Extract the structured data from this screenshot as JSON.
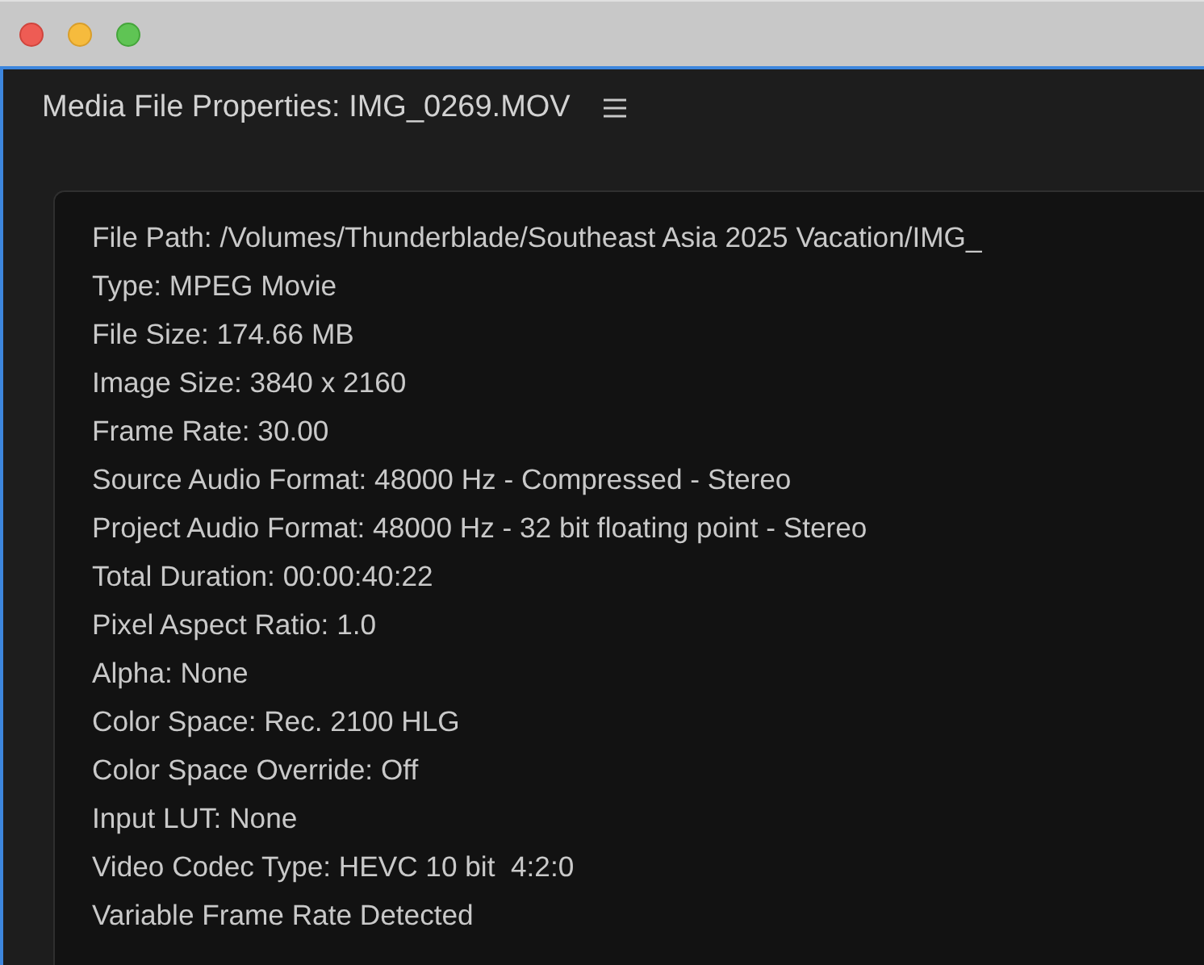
{
  "window": {
    "title": "Media File Properties: IMG_0269.MOV"
  },
  "properties": [
    "File Path: /Volumes/Thunderblade/Southeast Asia 2025 Vacation/IMG_",
    "Type: MPEG Movie",
    "File Size: 174.66 MB",
    "Image Size: 3840 x 2160",
    "Frame Rate: 30.00",
    "Source Audio Format: 48000 Hz - Compressed - Stereo",
    "Project Audio Format: 48000 Hz - 32 bit floating point - Stereo",
    "Total Duration: 00:00:40:22",
    "Pixel Aspect Ratio: 1.0",
    "Alpha: None",
    "Color Space: Rec. 2100 HLG",
    "Color Space Override: Off",
    "Input LUT: None",
    "Video Codec Type: HEVC 10 bit  4:2:0",
    "Variable Frame Rate Detected"
  ]
}
